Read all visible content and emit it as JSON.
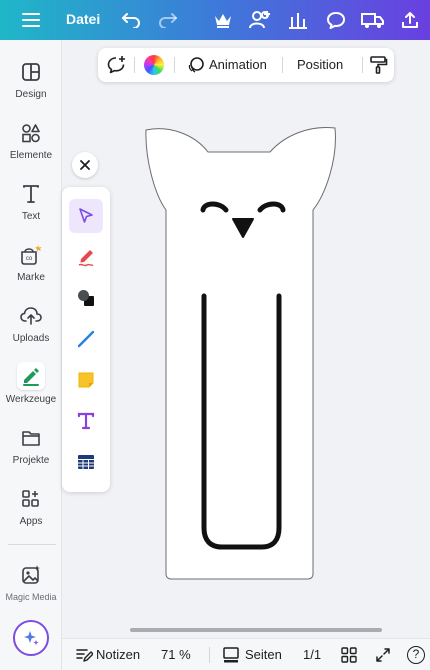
{
  "topbar": {
    "file_label": "Datei",
    "icons": [
      "menu-icon",
      "undo-icon",
      "redo-icon",
      "crown-icon",
      "share-people-icon",
      "insights-icon",
      "comment-icon",
      "delivery-truck-icon",
      "export-upload-icon"
    ]
  },
  "sidebar": {
    "items": [
      {
        "label": "Design",
        "icon": "design-icon"
      },
      {
        "label": "Elemente",
        "icon": "elements-icon"
      },
      {
        "label": "Text",
        "icon": "text-icon"
      },
      {
        "label": "Marke",
        "icon": "brand-icon"
      },
      {
        "label": "Uploads",
        "icon": "upload-cloud-icon"
      },
      {
        "label": "Werkzeuge",
        "icon": "tools-icon"
      },
      {
        "label": "Projekte",
        "icon": "folder-icon"
      },
      {
        "label": "Apps",
        "icon": "apps-icon"
      },
      {
        "label": "Magic Media",
        "icon": "magic-media-icon"
      }
    ],
    "active": "Werkzeuge"
  },
  "context_toolbar": {
    "animation_label": "Animation",
    "position_label": "Position"
  },
  "palette": {
    "tools": [
      "select-arrow-icon",
      "pen-icon",
      "shapes-icon",
      "line-icon",
      "sticky-note-icon",
      "text-tool-icon",
      "table-icon"
    ]
  },
  "bottombar": {
    "notes_label": "Notizen",
    "zoom": "71 %",
    "pages_label": "Seiten",
    "page_indicator": "1/1",
    "help": "?"
  },
  "colors": {
    "accent": "#7b4de3",
    "gradient_start": "#1fb7c8",
    "gradient_end": "#6a3fe0"
  }
}
